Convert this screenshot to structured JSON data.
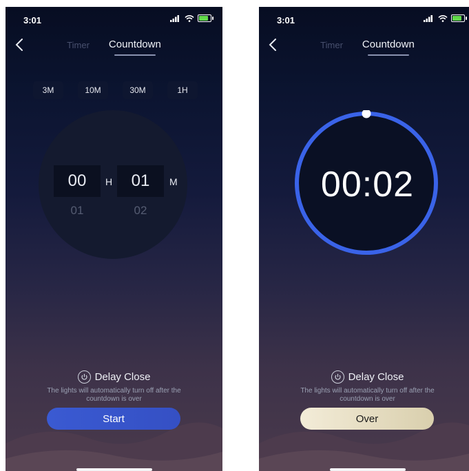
{
  "left_screen": {
    "status": {
      "time": "3:01"
    },
    "tabs": [
      {
        "label": "Timer"
      },
      {
        "label": "Countdown"
      }
    ],
    "presets": [
      "3M",
      "10M",
      "30M",
      "1H"
    ],
    "picker": {
      "hours_selected": "00",
      "hours_next": "01",
      "hours_unit": "H",
      "minutes_selected": "01",
      "minutes_next": "02",
      "minutes_unit": "M"
    },
    "delay_title": "Delay Close",
    "delay_desc": "The lights will automatically turn off after the countdown is over",
    "button_label": "Start"
  },
  "right_screen": {
    "status": {
      "time": "3:01"
    },
    "tabs": [
      {
        "label": "Timer"
      },
      {
        "label": "Countdown"
      }
    ],
    "countdown_display": "00:02",
    "delay_title": "Delay Close",
    "delay_desc": "The lights will automatically turn off after the countdown is over",
    "button_label": "Over"
  },
  "colors": {
    "ring": "#3a63e8",
    "start_button": "#3a5ad2",
    "over_button": "#e9dfc0",
    "battery": "#62d94a"
  },
  "icons": {
    "back": "chevron-left-icon",
    "signal": "signal-icon",
    "wifi": "wifi-icon",
    "battery": "battery-charging-icon",
    "power": "power-icon"
  }
}
